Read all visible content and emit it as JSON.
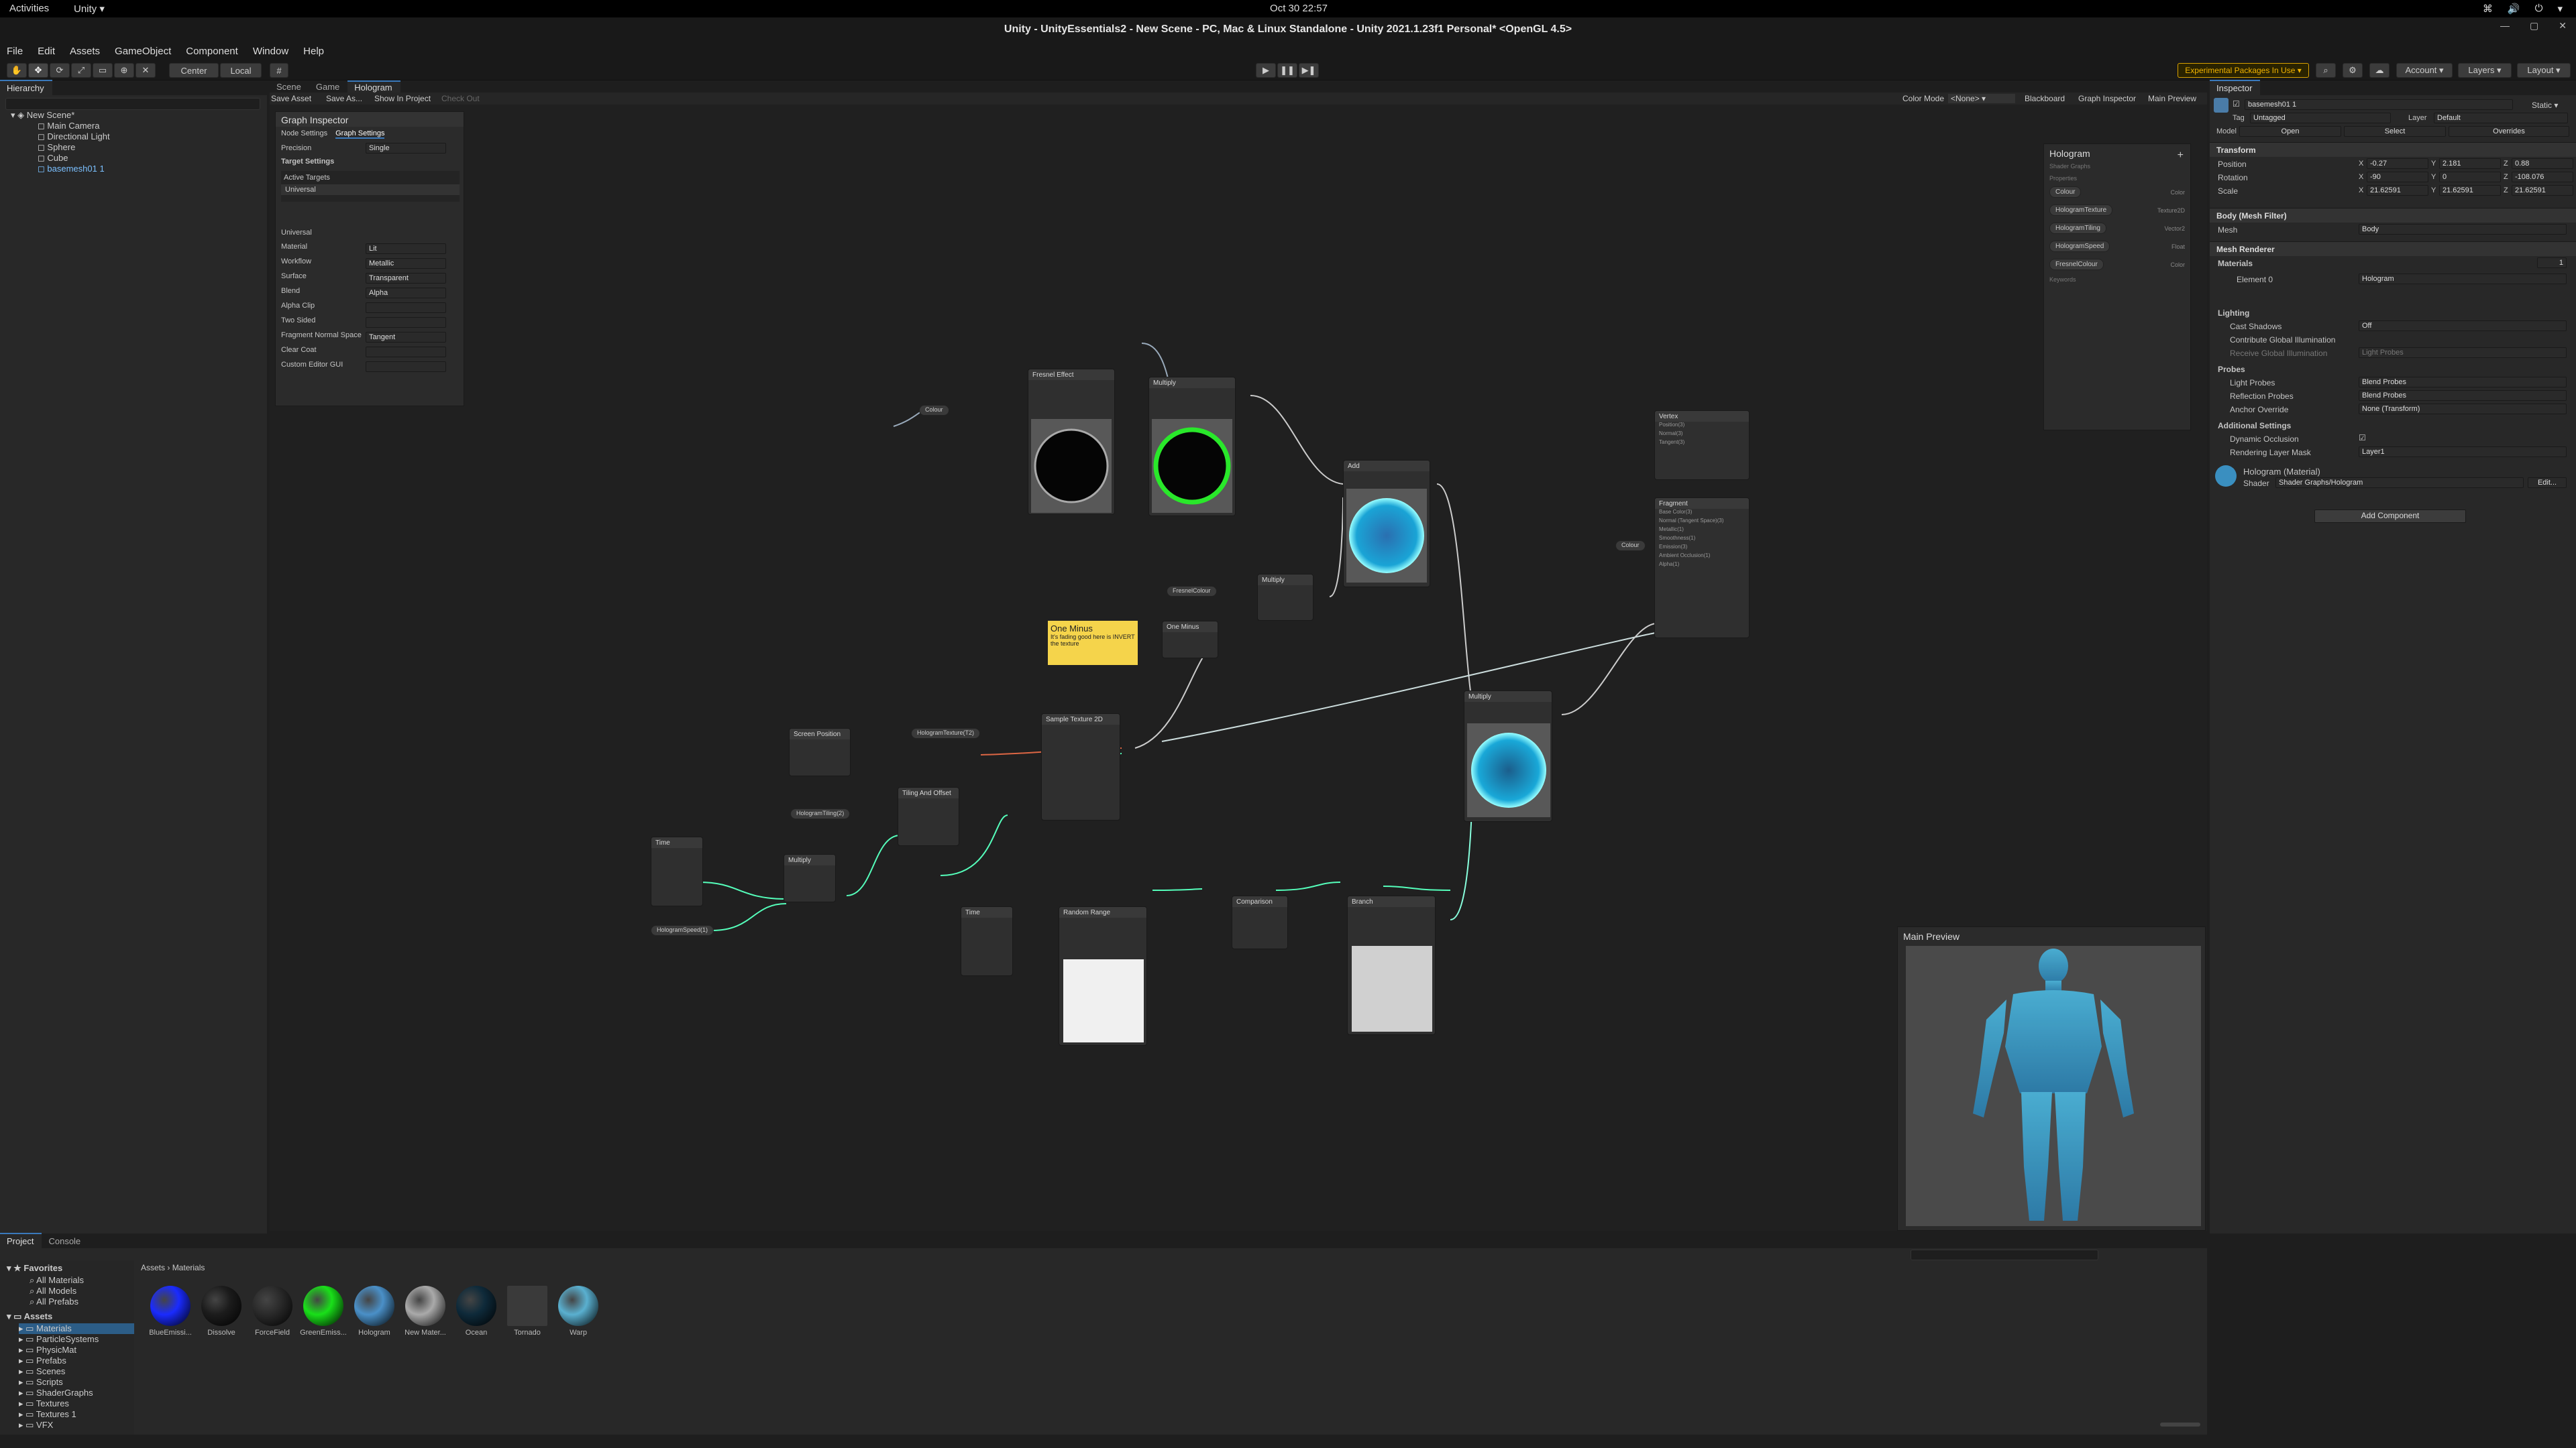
{
  "topbar": {
    "activities": "Activities",
    "app": "Unity ▾",
    "clock": "Oct 30  22:57"
  },
  "window": {
    "title": "Unity - UnityEssentials2 - New Scene - PC, Mac & Linux Standalone - Unity 2021.1.23f1 Personal* <OpenGL 4.5>"
  },
  "menu": [
    "File",
    "Edit",
    "Assets",
    "GameObject",
    "Component",
    "Window",
    "Help"
  ],
  "toolbar": {
    "center": "Center",
    "local": "Local",
    "experimental": "Experimental Packages In Use ▾",
    "account": "Account ▾",
    "layers": "Layers ▾",
    "layout": "Layout ▾"
  },
  "hierarchy": {
    "tab": "Hierarchy",
    "scene": "New Scene*",
    "items": [
      "Main Camera",
      "Directional Light",
      "Sphere",
      "Cube",
      "basemesh01 1"
    ]
  },
  "center_tabs": [
    "Scene",
    "Game",
    "Hologram"
  ],
  "graph_toolbar": {
    "save": "Save Asset",
    "save_as": "Save As...",
    "show": "Show In Project",
    "checkout": "Check Out",
    "color_mode": "Color Mode",
    "color_value": "<None> ▾",
    "blackboard": "Blackboard",
    "graph_inspector": "Graph Inspector",
    "main_preview": "Main Preview"
  },
  "graph_inspector": {
    "title": "Graph Inspector",
    "tabs": [
      "Node Settings",
      "Graph Settings"
    ],
    "precision_label": "Precision",
    "precision": "Single",
    "target_settings": "Target Settings",
    "active_targets": "Active Targets",
    "target": "Universal",
    "universal": "Universal",
    "rows": [
      {
        "label": "Material",
        "value": "Lit"
      },
      {
        "label": "Workflow",
        "value": "Metallic"
      },
      {
        "label": "Surface",
        "value": "Transparent"
      },
      {
        "label": "Blend",
        "value": "Alpha"
      },
      {
        "label": "Alpha Clip",
        "value": ""
      },
      {
        "label": "Two Sided",
        "value": ""
      },
      {
        "label": "Fragment Normal Space",
        "value": "Tangent"
      },
      {
        "label": "Clear Coat",
        "value": ""
      },
      {
        "label": "Custom Editor GUI",
        "value": ""
      }
    ]
  },
  "blackboard": {
    "title": "Hologram",
    "subtitle": "Shader Graphs",
    "properties_label": "Properties",
    "props": [
      {
        "name": "Colour",
        "type": "Color"
      },
      {
        "name": "HologramTexture",
        "type": "Texture2D"
      },
      {
        "name": "HologramTiling",
        "type": "Vector2"
      },
      {
        "name": "HologramSpeed",
        "type": "Float"
      },
      {
        "name": "FresnelColour",
        "type": "Color"
      }
    ],
    "keywords_label": "Keywords"
  },
  "nodes": {
    "fresnel": "Fresnel Effect",
    "multiply1": "Multiply",
    "add": "Add",
    "multiply2": "Multiply",
    "one_minus": "One Minus",
    "sticky_title": "One Minus",
    "sticky_body": "It's fading good here is INVERT the texture",
    "sample": "Sample Texture 2D",
    "screen_pos": "Screen Position",
    "tiling": "Tiling And Offset",
    "time1": "Time",
    "multiply3": "Multiply",
    "time2": "Time",
    "random": "Random Range",
    "comparison": "Comparison",
    "branch": "Branch",
    "multiply4": "Multiply",
    "vertex": "Vertex",
    "fragment": "Fragment",
    "vertex_ports": [
      "Position(3)",
      "Normal(3)",
      "Tangent(3)"
    ],
    "fragment_ports": [
      "Base Color(3)",
      "Normal (Tangent Space)(3)",
      "Metallic(1)",
      "Smoothness(1)",
      "Emission(3)",
      "Ambient Occlusion(1)",
      "Alpha(1)"
    ],
    "prop_colour": "Colour",
    "prop_fresnel": "FresnelColour",
    "prop_tex": "HologramTexture(T2)",
    "prop_tiling": "HologramTiling(2)",
    "prop_speed": "HologramSpeed(1)"
  },
  "main_preview": {
    "title": "Main Preview"
  },
  "inspector": {
    "tab": "Inspector",
    "object_name": "basemesh01 1",
    "static": "Static ▾",
    "tag_label": "Tag",
    "tag": "Untagged",
    "layer_label": "Layer",
    "layer": "Default",
    "model_label": "Model",
    "open": "Open",
    "select": "Select",
    "overrides": "Overrides",
    "transform": "Transform",
    "position_label": "Position",
    "pos": [
      "-0.27",
      "2.181",
      "0.88"
    ],
    "rotation_label": "Rotation",
    "rot": [
      "-90",
      "0",
      "-108.076"
    ],
    "scale_label": "Scale",
    "scale": [
      "21.62591",
      "21.62591",
      "21.62591"
    ],
    "mesh_filter": "Body (Mesh Filter)",
    "mesh_label": "Mesh",
    "mesh": "Body",
    "mesh_renderer": "Mesh Renderer",
    "materials_label": "Materials",
    "materials_count": "1",
    "element_label": "Element 0",
    "element": "Hologram",
    "lighting": "Lighting",
    "cast_shadows_label": "Cast Shadows",
    "cast_shadows": "Off",
    "contribute_gi": "Contribute Global Illumination",
    "receive_gi_label": "Receive Global Illumination",
    "receive_gi": "Light Probes",
    "probes": "Probes",
    "light_probes_label": "Light Probes",
    "light_probes": "Blend Probes",
    "reflection_probes_label": "Reflection Probes",
    "reflection_probes": "Blend Probes",
    "anchor_label": "Anchor Override",
    "anchor": "None (Transform)",
    "additional": "Additional Settings",
    "dynamic_occlusion": "Dynamic Occlusion",
    "rendering_layer_label": "Rendering Layer Mask",
    "rendering_layer": "Layer1",
    "material_name": "Hologram (Material)",
    "shader_label": "Shader",
    "shader": "Shader Graphs/Hologram",
    "edit": "Edit...",
    "add_component": "Add Component"
  },
  "project": {
    "tabs": [
      "Project",
      "Console"
    ],
    "favorites": "Favorites",
    "fav_items": [
      "All Materials",
      "All Models",
      "All Prefabs"
    ],
    "assets": "Assets",
    "folders": [
      "Materials",
      "ParticleSystems",
      "PhysicMat",
      "Prefabs",
      "Scenes",
      "Scripts",
      "ShaderGraphs",
      "Textures",
      "Textures 1",
      "VFX"
    ],
    "breadcrumb": [
      "Assets",
      "Materials"
    ],
    "items": [
      {
        "name": "BlueEmissi...",
        "color": "#1a2bff"
      },
      {
        "name": "Dissolve",
        "color": "#1c1c1c"
      },
      {
        "name": "ForceField",
        "color": "#2a2a2a"
      },
      {
        "name": "GreenEmiss...",
        "color": "#19e019"
      },
      {
        "name": "Hologram",
        "color": "#4a90c8"
      },
      {
        "name": "New Mater...",
        "color": "#aaaaaa"
      },
      {
        "name": "Ocean",
        "color": "#0e2a3a"
      },
      {
        "name": "Tornado",
        "color": "#3a3a3a"
      },
      {
        "name": "Warp",
        "color": "#5ab0d0"
      }
    ]
  }
}
